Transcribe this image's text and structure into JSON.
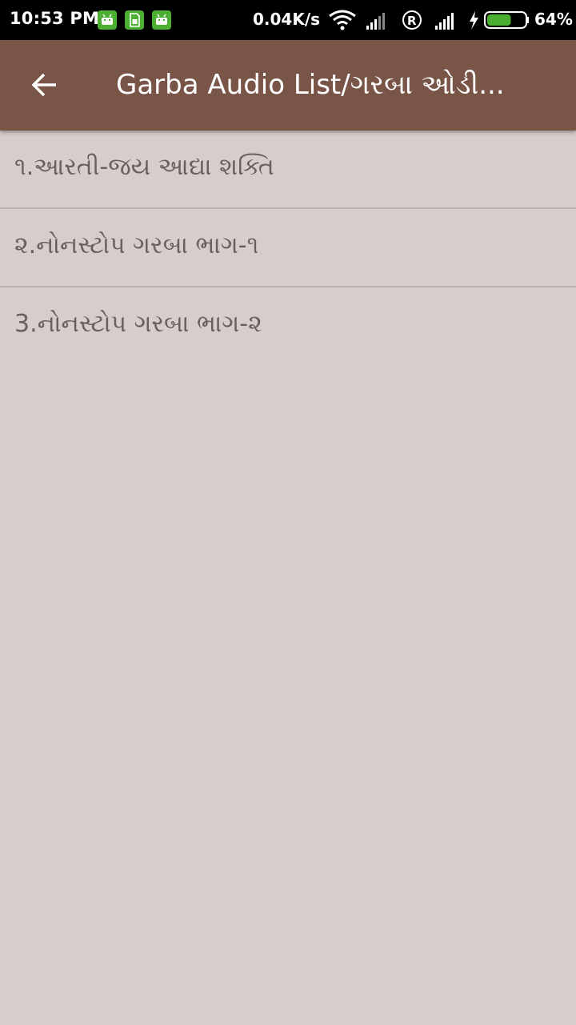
{
  "status_bar": {
    "time": "10:53 PM",
    "network_speed": "0.04K/s",
    "battery_percent": "64%",
    "notification_icons": [
      "android-icon",
      "sim-icon",
      "android-icon"
    ],
    "battery_level": 0.64
  },
  "app_bar": {
    "title": "Garba Audio List/ગરબા ઓડી...",
    "back_icon": "arrow-left-icon",
    "color": "#795548"
  },
  "list": {
    "items": [
      {
        "label": "૧.આરતી-જય આદ્યા શક્તિ"
      },
      {
        "label": "૨.નોનસ્ટોપ ગરબા ભાગ-૧"
      },
      {
        "label": "3.નોનસ્ટોપ ગરબા ભાગ-૨"
      }
    ]
  },
  "colors": {
    "background": "#d7cdcb",
    "text": "#6a5f5d",
    "divider": "#bcb3b1",
    "notification_green": "#4caf32"
  }
}
